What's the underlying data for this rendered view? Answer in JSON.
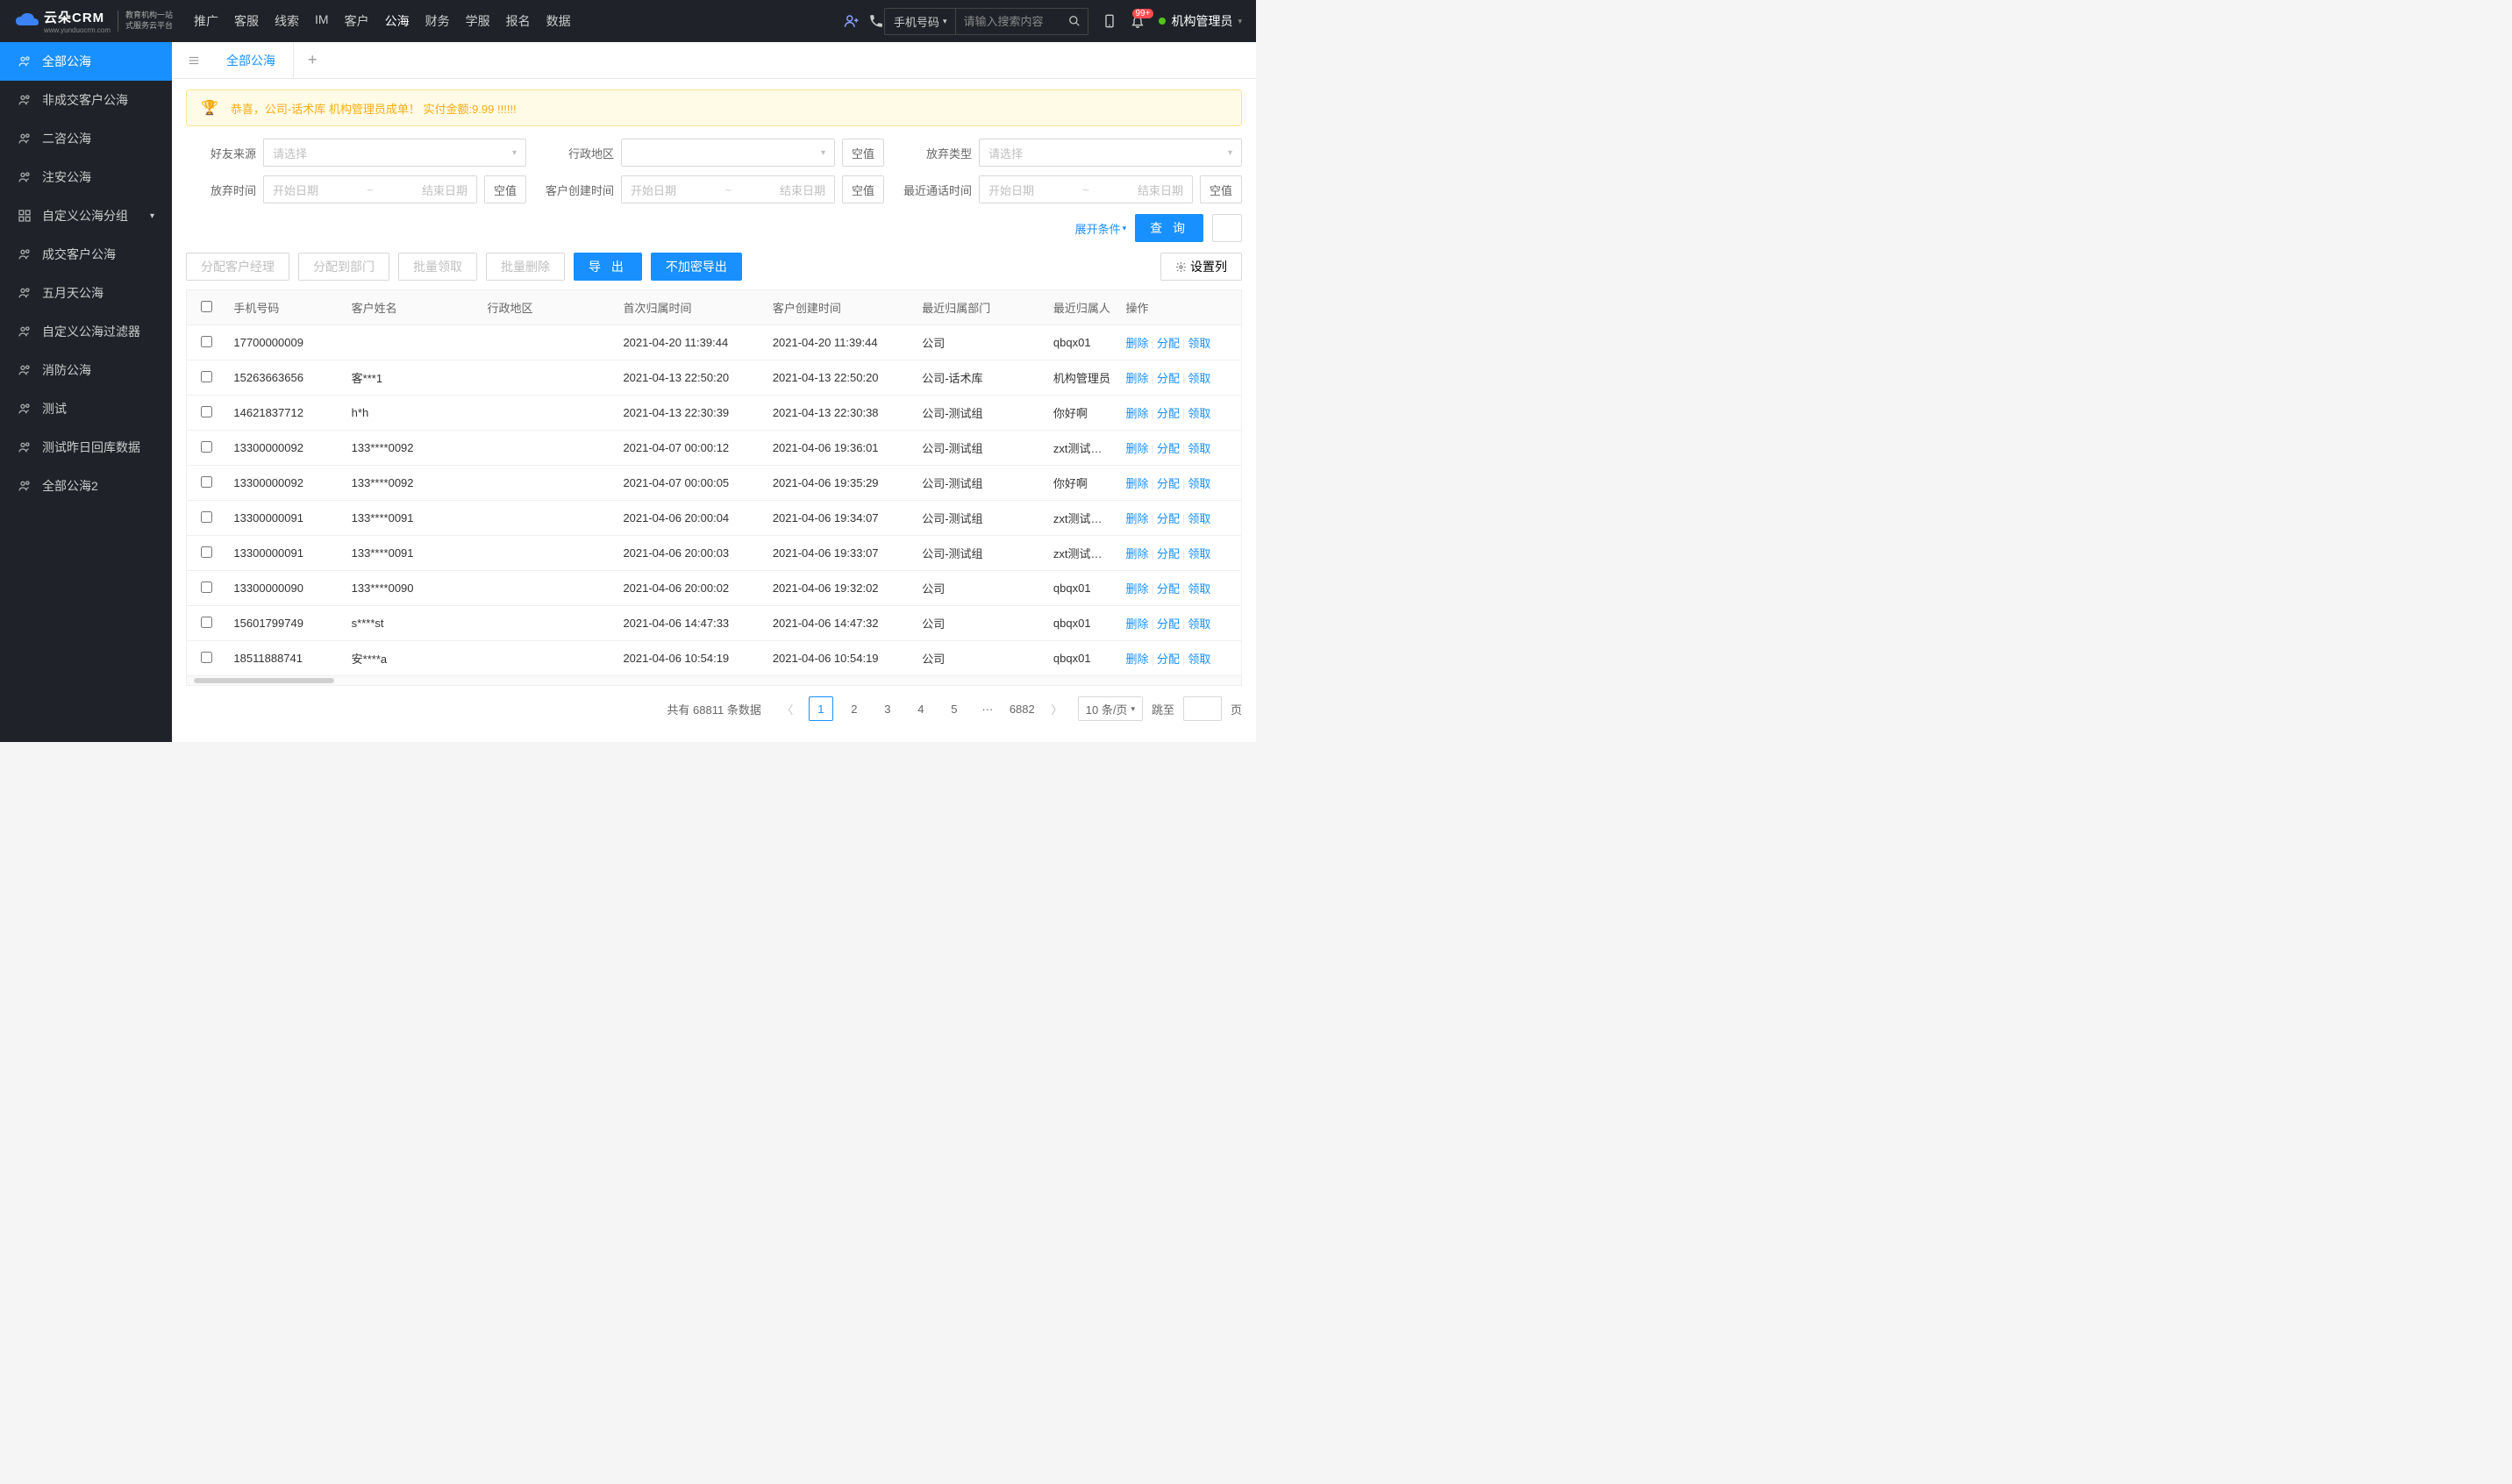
{
  "brand": {
    "name": "云朵CRM",
    "sub1": "教育机构一站",
    "sub2": "式服务云平台",
    "url": "www.yunduocrm.com"
  },
  "topnav": {
    "items": [
      "推广",
      "客服",
      "线索",
      "IM",
      "客户",
      "公海",
      "财务",
      "学服",
      "报名",
      "数据"
    ],
    "active": 5
  },
  "search": {
    "type": "手机号码",
    "placeholder": "请输入搜索内容"
  },
  "notif": {
    "count": "99+"
  },
  "user": {
    "name": "机构管理员"
  },
  "sidebar": {
    "items": [
      {
        "label": "全部公海",
        "icon": "icon-users",
        "active": true
      },
      {
        "label": "非成交客户公海",
        "icon": "icon-users"
      },
      {
        "label": "二咨公海",
        "icon": "icon-users"
      },
      {
        "label": "注安公海",
        "icon": "icon-users"
      },
      {
        "label": "自定义公海分组",
        "icon": "icon-layers",
        "expandable": true
      },
      {
        "label": "成交客户公海",
        "icon": "icon-users"
      },
      {
        "label": "五月天公海",
        "icon": "icon-users"
      },
      {
        "label": "自定义公海过滤器",
        "icon": "icon-users"
      },
      {
        "label": "消防公海",
        "icon": "icon-users"
      },
      {
        "label": "测试",
        "icon": "icon-users"
      },
      {
        "label": "测试昨日回库数据",
        "icon": "icon-users"
      },
      {
        "label": "全部公海2",
        "icon": "icon-users"
      }
    ]
  },
  "tabs": {
    "items": [
      "全部公海"
    ]
  },
  "banner": {
    "text": "恭喜，公司-话术库  机构管理员成单！  实付金额:9.99 !!!!!!"
  },
  "filters": {
    "source": {
      "label": "好友来源",
      "placeholder": "请选择"
    },
    "region": {
      "label": "行政地区",
      "placeholder": "",
      "empty": "空值"
    },
    "abandon_type": {
      "label": "放弃类型",
      "placeholder": "请选择"
    },
    "abandon_time": {
      "label": "放弃时间",
      "start": "开始日期",
      "end": "结束日期",
      "empty": "空值"
    },
    "create_time": {
      "label": "客户创建时间",
      "start": "开始日期",
      "end": "结束日期",
      "empty": "空值"
    },
    "last_call": {
      "label": "最近通话时间",
      "start": "开始日期",
      "end": "结束日期",
      "empty": "空值"
    },
    "expand": "展开条件",
    "query": "查 询"
  },
  "toolbar": {
    "assign_mgr": "分配客户经理",
    "assign_dept": "分配到部门",
    "batch_claim": "批量领取",
    "batch_delete": "批量删除",
    "export": "导 出",
    "export_plain": "不加密导出",
    "set_cols": "设置列"
  },
  "table": {
    "headers": {
      "phone": "手机号码",
      "name": "客户姓名",
      "region": "行政地区",
      "first_time": "首次归属时间",
      "create_time": "客户创建时间",
      "last_dept": "最近归属部门",
      "last_person": "最近归属人",
      "ops": "操作"
    },
    "ops": {
      "delete": "删除",
      "assign": "分配",
      "claim": "领取"
    },
    "rows": [
      {
        "phone": "17700000009",
        "name": "",
        "region": "",
        "first_time": "2021-04-20 11:39:44",
        "create_time": "2021-04-20 11:39:44",
        "last_dept": "公司",
        "last_person": "qbqx01"
      },
      {
        "phone": "15263663656",
        "name": "客***1",
        "region": "",
        "first_time": "2021-04-13 22:50:20",
        "create_time": "2021-04-13 22:50:20",
        "last_dept": "公司-话术库",
        "last_person": "机构管理员"
      },
      {
        "phone": "14621837712",
        "name": "h*h",
        "region": "",
        "first_time": "2021-04-13 22:30:39",
        "create_time": "2021-04-13 22:30:38",
        "last_dept": "公司-测试组",
        "last_person": "你好啊"
      },
      {
        "phone": "13300000092",
        "name": "133****0092",
        "region": "",
        "first_time": "2021-04-07 00:00:12",
        "create_time": "2021-04-06 19:36:01",
        "last_dept": "公司-测试组",
        "last_person": "zxt测试导入"
      },
      {
        "phone": "13300000092",
        "name": "133****0092",
        "region": "",
        "first_time": "2021-04-07 00:00:05",
        "create_time": "2021-04-06 19:35:29",
        "last_dept": "公司-测试组",
        "last_person": "你好啊"
      },
      {
        "phone": "13300000091",
        "name": "133****0091",
        "region": "",
        "first_time": "2021-04-06 20:00:04",
        "create_time": "2021-04-06 19:34:07",
        "last_dept": "公司-测试组",
        "last_person": "zxt测试导入"
      },
      {
        "phone": "13300000091",
        "name": "133****0091",
        "region": "",
        "first_time": "2021-04-06 20:00:03",
        "create_time": "2021-04-06 19:33:07",
        "last_dept": "公司-测试组",
        "last_person": "zxt测试导入"
      },
      {
        "phone": "13300000090",
        "name": "133****0090",
        "region": "",
        "first_time": "2021-04-06 20:00:02",
        "create_time": "2021-04-06 19:32:02",
        "last_dept": "公司",
        "last_person": "qbqx01"
      },
      {
        "phone": "15601799749",
        "name": "s****st",
        "region": "",
        "first_time": "2021-04-06 14:47:33",
        "create_time": "2021-04-06 14:47:32",
        "last_dept": "公司",
        "last_person": "qbqx01"
      },
      {
        "phone": "18511888741",
        "name": "安****a",
        "region": "",
        "first_time": "2021-04-06 10:54:19",
        "create_time": "2021-04-06 10:54:19",
        "last_dept": "公司",
        "last_person": "qbqx01"
      }
    ]
  },
  "pagination": {
    "total_label_prefix": "共有",
    "total": "68811",
    "total_label_suffix": "条数据",
    "pages": [
      "1",
      "2",
      "3",
      "4",
      "5"
    ],
    "ellipsis": "···",
    "last": "6882",
    "page_size": "10 条/页",
    "jump_label": "跳至",
    "jump_suffix": "页"
  }
}
